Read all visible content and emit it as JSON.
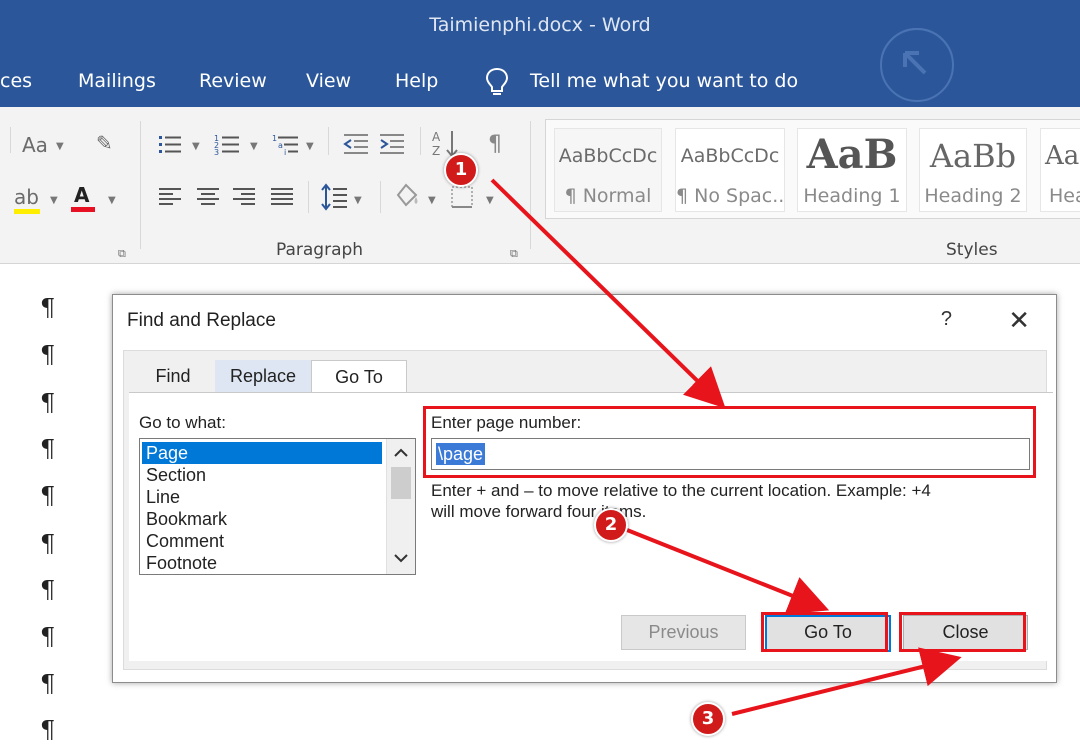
{
  "window": {
    "title": "Taimienphi.docx  -  Word"
  },
  "menu": {
    "items": [
      "ces",
      "Mailings",
      "Review",
      "View",
      "Help"
    ],
    "tell_me": "Tell me what you want to do"
  },
  "ribbon": {
    "font_size_label": "Aa",
    "paragraph_group_label": "Paragraph",
    "styles_group_label": "Styles",
    "styles": [
      {
        "sample": "AaBbCcDc",
        "name": "¶ Normal"
      },
      {
        "sample": "AaBbCcDc",
        "name": "¶ No Spac..."
      },
      {
        "sample": "AaB",
        "name": "Heading 1"
      },
      {
        "sample": "AaBb",
        "name": "Heading 2"
      },
      {
        "sample": "Aa",
        "name": "Hea"
      }
    ]
  },
  "document": {
    "pilcrow": "¶"
  },
  "dialog": {
    "title": "Find and Replace",
    "help": "?",
    "close_glyph": "✕",
    "tabs": [
      "Find",
      "Replace",
      "Go To"
    ],
    "goto_what_label": "Go to what:",
    "goto_items": [
      "Page",
      "Section",
      "Line",
      "Bookmark",
      "Comment",
      "Footnote"
    ],
    "selected_item": "Page",
    "enter_label": "Enter page number:",
    "input_value": "\\page",
    "hint_line1": "Enter + and – to move relative to the current location. Example: +4",
    "hint_line2": "will move forward four items.",
    "buttons": {
      "previous": "Previous",
      "goto": "Go To",
      "close": "Close"
    }
  },
  "annotations": {
    "badge1": "1",
    "badge2": "2",
    "badge3": "3"
  },
  "colors": {
    "word_blue": "#2b579a",
    "annotation_red": "#e8141c",
    "selection_blue": "#0078d7"
  },
  "icons": [
    "lightbulb-icon",
    "bullets-icon",
    "numbering-icon",
    "multilevel-list-icon",
    "decrease-indent-icon",
    "increase-indent-icon",
    "sort-icon",
    "show-marks-icon",
    "align-left-icon",
    "center-icon",
    "align-right-icon",
    "justify-icon",
    "line-spacing-icon",
    "shading-icon",
    "borders-icon",
    "clear-format-icon",
    "highlight-icon",
    "font-color-icon",
    "scroll-up-icon",
    "scroll-down-icon"
  ]
}
